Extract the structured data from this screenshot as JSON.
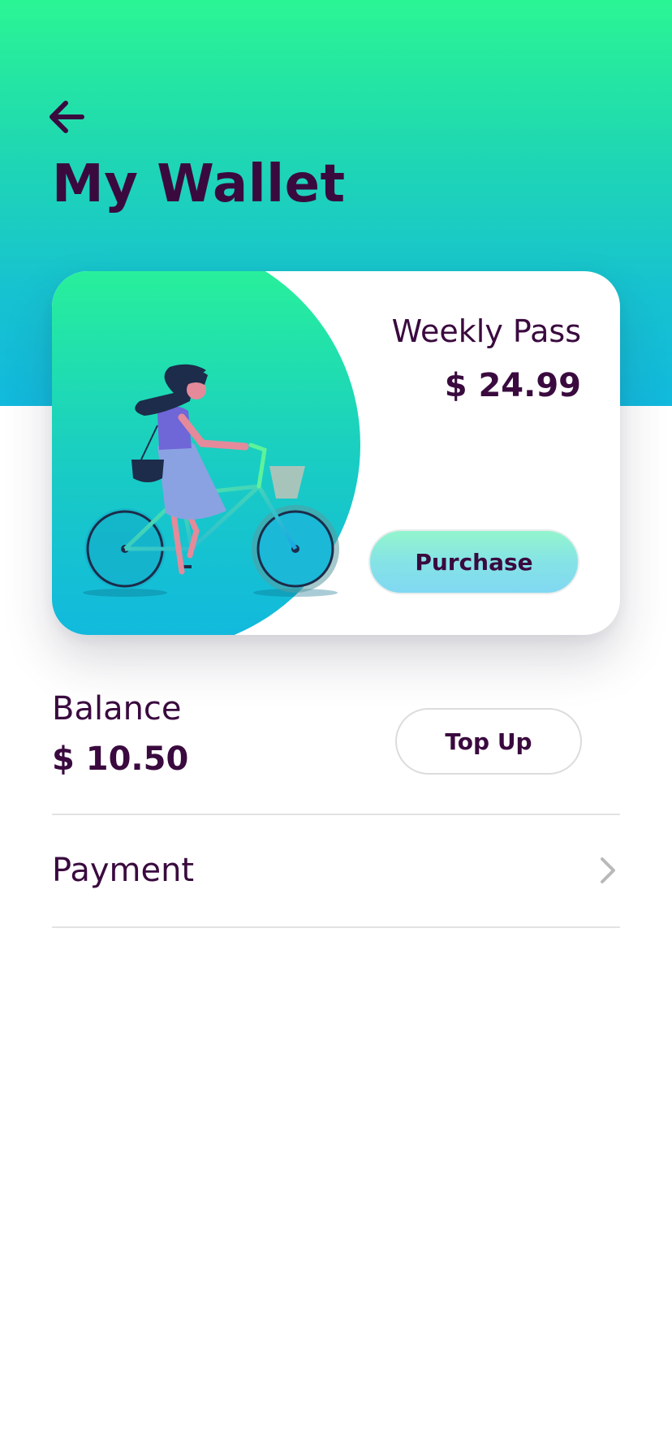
{
  "header": {
    "back_icon": "arrow-left-icon",
    "title": "My Wallet"
  },
  "pass_card": {
    "illustration": "woman-riding-bicycle-illustration",
    "name": "Weekly Pass",
    "price": "$ 24.99",
    "purchase_label": "Purchase"
  },
  "balance": {
    "label": "Balance",
    "value": "$ 10.50",
    "topup_label": "Top Up"
  },
  "payment": {
    "label": "Payment",
    "chevron_icon": "chevron-right-icon"
  },
  "colors": {
    "primary_text": "#3a0a3f",
    "gradient_top": "#2af594",
    "gradient_bottom": "#12b9dd",
    "divider": "#e2e2e2"
  }
}
